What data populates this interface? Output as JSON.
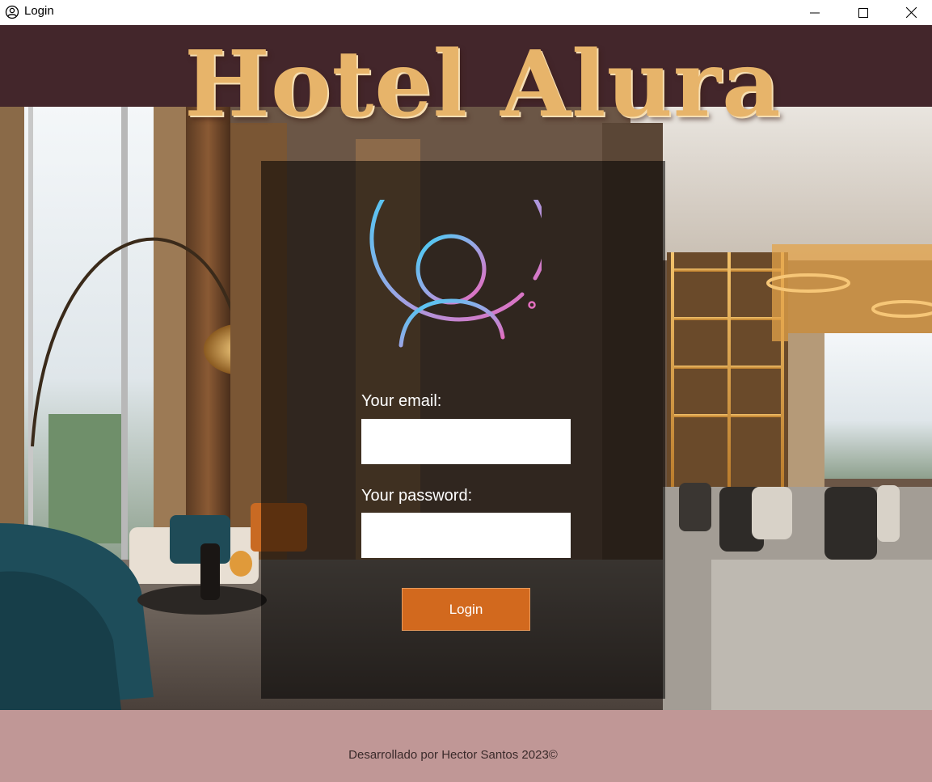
{
  "window": {
    "title": "Login",
    "icon": "user-circle-icon"
  },
  "controls": {
    "minimize_icon": "minimize-icon",
    "maximize_icon": "maximize-icon",
    "close_icon": "close-icon"
  },
  "header": {
    "title": "Hotel Alura",
    "title_color": "#e7b46a",
    "band_color": "#43262b"
  },
  "login": {
    "email_label": "Your email:",
    "email_value": "",
    "password_label": "Your password:",
    "password_value": "",
    "button_label": "Login",
    "button_color": "#d2691e",
    "avatar_icon": "user-avatar-icon"
  },
  "footer": {
    "text": "Desarrollado por Hector Santos 2023©",
    "background": "#c09796"
  }
}
